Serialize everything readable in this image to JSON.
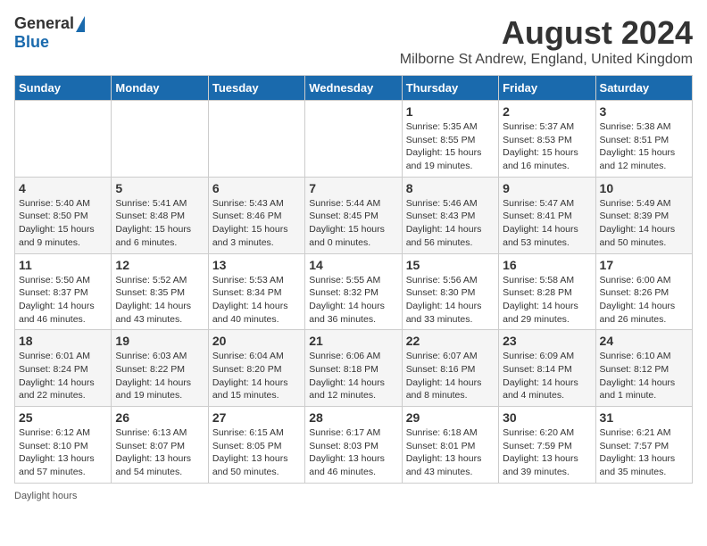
{
  "logo": {
    "general": "General",
    "blue": "Blue"
  },
  "title": "August 2024",
  "subtitle": "Milborne St Andrew, England, United Kingdom",
  "days_of_week": [
    "Sunday",
    "Monday",
    "Tuesday",
    "Wednesday",
    "Thursday",
    "Friday",
    "Saturday"
  ],
  "footer": "Daylight hours",
  "weeks": [
    [
      {
        "day": "",
        "info": ""
      },
      {
        "day": "",
        "info": ""
      },
      {
        "day": "",
        "info": ""
      },
      {
        "day": "",
        "info": ""
      },
      {
        "day": "1",
        "info": "Sunrise: 5:35 AM\nSunset: 8:55 PM\nDaylight: 15 hours\nand 19 minutes."
      },
      {
        "day": "2",
        "info": "Sunrise: 5:37 AM\nSunset: 8:53 PM\nDaylight: 15 hours\nand 16 minutes."
      },
      {
        "day": "3",
        "info": "Sunrise: 5:38 AM\nSunset: 8:51 PM\nDaylight: 15 hours\nand 12 minutes."
      }
    ],
    [
      {
        "day": "4",
        "info": "Sunrise: 5:40 AM\nSunset: 8:50 PM\nDaylight: 15 hours\nand 9 minutes."
      },
      {
        "day": "5",
        "info": "Sunrise: 5:41 AM\nSunset: 8:48 PM\nDaylight: 15 hours\nand 6 minutes."
      },
      {
        "day": "6",
        "info": "Sunrise: 5:43 AM\nSunset: 8:46 PM\nDaylight: 15 hours\nand 3 minutes."
      },
      {
        "day": "7",
        "info": "Sunrise: 5:44 AM\nSunset: 8:45 PM\nDaylight: 15 hours\nand 0 minutes."
      },
      {
        "day": "8",
        "info": "Sunrise: 5:46 AM\nSunset: 8:43 PM\nDaylight: 14 hours\nand 56 minutes."
      },
      {
        "day": "9",
        "info": "Sunrise: 5:47 AM\nSunset: 8:41 PM\nDaylight: 14 hours\nand 53 minutes."
      },
      {
        "day": "10",
        "info": "Sunrise: 5:49 AM\nSunset: 8:39 PM\nDaylight: 14 hours\nand 50 minutes."
      }
    ],
    [
      {
        "day": "11",
        "info": "Sunrise: 5:50 AM\nSunset: 8:37 PM\nDaylight: 14 hours\nand 46 minutes."
      },
      {
        "day": "12",
        "info": "Sunrise: 5:52 AM\nSunset: 8:35 PM\nDaylight: 14 hours\nand 43 minutes."
      },
      {
        "day": "13",
        "info": "Sunrise: 5:53 AM\nSunset: 8:34 PM\nDaylight: 14 hours\nand 40 minutes."
      },
      {
        "day": "14",
        "info": "Sunrise: 5:55 AM\nSunset: 8:32 PM\nDaylight: 14 hours\nand 36 minutes."
      },
      {
        "day": "15",
        "info": "Sunrise: 5:56 AM\nSunset: 8:30 PM\nDaylight: 14 hours\nand 33 minutes."
      },
      {
        "day": "16",
        "info": "Sunrise: 5:58 AM\nSunset: 8:28 PM\nDaylight: 14 hours\nand 29 minutes."
      },
      {
        "day": "17",
        "info": "Sunrise: 6:00 AM\nSunset: 8:26 PM\nDaylight: 14 hours\nand 26 minutes."
      }
    ],
    [
      {
        "day": "18",
        "info": "Sunrise: 6:01 AM\nSunset: 8:24 PM\nDaylight: 14 hours\nand 22 minutes."
      },
      {
        "day": "19",
        "info": "Sunrise: 6:03 AM\nSunset: 8:22 PM\nDaylight: 14 hours\nand 19 minutes."
      },
      {
        "day": "20",
        "info": "Sunrise: 6:04 AM\nSunset: 8:20 PM\nDaylight: 14 hours\nand 15 minutes."
      },
      {
        "day": "21",
        "info": "Sunrise: 6:06 AM\nSunset: 8:18 PM\nDaylight: 14 hours\nand 12 minutes."
      },
      {
        "day": "22",
        "info": "Sunrise: 6:07 AM\nSunset: 8:16 PM\nDaylight: 14 hours\nand 8 minutes."
      },
      {
        "day": "23",
        "info": "Sunrise: 6:09 AM\nSunset: 8:14 PM\nDaylight: 14 hours\nand 4 minutes."
      },
      {
        "day": "24",
        "info": "Sunrise: 6:10 AM\nSunset: 8:12 PM\nDaylight: 14 hours\nand 1 minute."
      }
    ],
    [
      {
        "day": "25",
        "info": "Sunrise: 6:12 AM\nSunset: 8:10 PM\nDaylight: 13 hours\nand 57 minutes."
      },
      {
        "day": "26",
        "info": "Sunrise: 6:13 AM\nSunset: 8:07 PM\nDaylight: 13 hours\nand 54 minutes."
      },
      {
        "day": "27",
        "info": "Sunrise: 6:15 AM\nSunset: 8:05 PM\nDaylight: 13 hours\nand 50 minutes."
      },
      {
        "day": "28",
        "info": "Sunrise: 6:17 AM\nSunset: 8:03 PM\nDaylight: 13 hours\nand 46 minutes."
      },
      {
        "day": "29",
        "info": "Sunrise: 6:18 AM\nSunset: 8:01 PM\nDaylight: 13 hours\nand 43 minutes."
      },
      {
        "day": "30",
        "info": "Sunrise: 6:20 AM\nSunset: 7:59 PM\nDaylight: 13 hours\nand 39 minutes."
      },
      {
        "day": "31",
        "info": "Sunrise: 6:21 AM\nSunset: 7:57 PM\nDaylight: 13 hours\nand 35 minutes."
      }
    ]
  ]
}
